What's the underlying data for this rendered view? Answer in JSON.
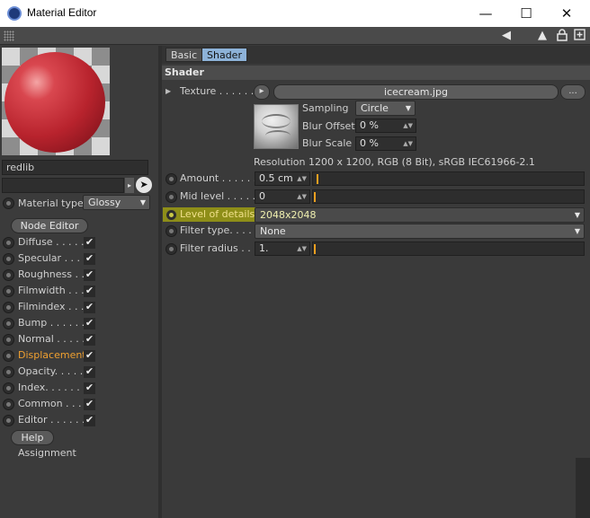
{
  "window": {
    "title": "Material Editor",
    "minimize": "—",
    "maximize": "☐",
    "close": "✕"
  },
  "left_panel": {
    "material_name": "redlib",
    "material_type_label": "Material type",
    "material_type_value": "Glossy",
    "node_editor_label": "Node Editor",
    "channels": [
      {
        "label": "Diffuse . . . . . ."
      },
      {
        "label": "Specular . . . . ."
      },
      {
        "label": "Roughness . . ."
      },
      {
        "label": "Filmwidth . . . ."
      },
      {
        "label": "Filmindex . . . ."
      },
      {
        "label": "Bump . . . . . . ."
      },
      {
        "label": "Normal . . . . . ."
      },
      {
        "label": "Displacement"
      },
      {
        "label": "Opacity. . . . . . ."
      },
      {
        "label": "Index. . . . . . . ."
      },
      {
        "label": "Common . . . . ."
      },
      {
        "label": "Editor . . . . . . ."
      }
    ],
    "check_mark": "✔",
    "help_label": "Help",
    "assignment_label": "Assignment"
  },
  "right_panel": {
    "tabs": [
      {
        "label": "Basic"
      },
      {
        "label": "Shader"
      }
    ],
    "section_title": "Shader",
    "texture_label": "Texture . . . . . . .",
    "texture_file": "icecream.jpg",
    "texture_more": "...",
    "sampling_label": "Sampling",
    "sampling_value": "Circle",
    "blur_offset_label": "Blur Offset",
    "blur_offset_value": "0 %",
    "blur_scale_label": "Blur Scale",
    "blur_scale_value": "0 %",
    "resolution_text": "Resolution 1200 x 1200, RGB (8 Bit), sRGB IEC61966-2.1",
    "amount_label": "Amount . . . . . . .",
    "amount_value": "0.5 cm",
    "mid_level_label": "Mid level . . . . . .",
    "mid_level_value": "0",
    "level_of_details_label": "Level of details",
    "level_of_details_value": "2048x2048",
    "filter_type_label": "Filter type. . . . . .",
    "filter_type_value": "None",
    "filter_radius_label": "Filter radius . . .",
    "filter_radius_value": "1."
  },
  "colors": {
    "accent_orange": "#f0a030",
    "highlight_yellow": "#8e8e18",
    "active_tab": "#8db2d8"
  }
}
